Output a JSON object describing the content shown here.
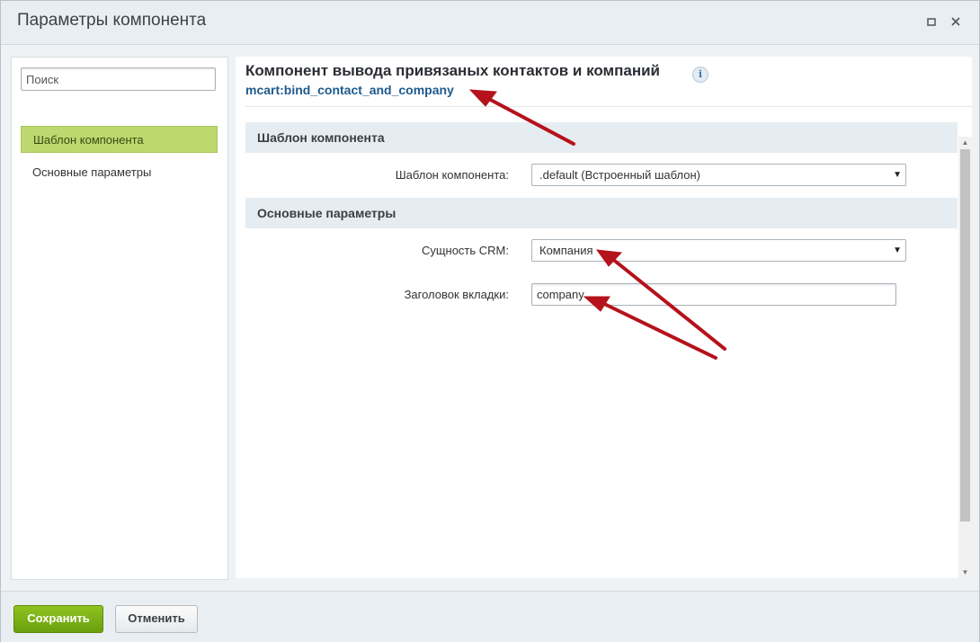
{
  "window": {
    "title": "Параметры компонента",
    "maximize_icon": "maximize-icon",
    "close_icon": "close-icon"
  },
  "sidebar": {
    "search_placeholder": "Поиск",
    "items": [
      {
        "label": "Шаблон компонента",
        "active": true
      },
      {
        "label": "Основные параметры",
        "active": false
      }
    ]
  },
  "component": {
    "title": "Компонент вывода привязаных контактов и компаний",
    "info_icon": "i",
    "code": "mcart:bind_contact_and_company"
  },
  "sections": [
    {
      "title": "Шаблон компонента",
      "fields": [
        {
          "label": "Шаблон компонента:",
          "type": "select",
          "value": ".default (Встроенный шаблон)"
        }
      ]
    },
    {
      "title": "Основные параметры",
      "fields": [
        {
          "label": "Сущность CRM:",
          "type": "select",
          "value": "Компания"
        },
        {
          "label": "Заголовок вкладки:",
          "type": "text",
          "value": "company"
        }
      ]
    }
  ],
  "footer": {
    "save_label": "Сохранить",
    "cancel_label": "Отменить"
  },
  "colors": {
    "accent_green": "#bcd86f",
    "save_button": "#7cb316",
    "link_blue": "#1e5a8c",
    "annotation_arrow": "#b5121b"
  }
}
